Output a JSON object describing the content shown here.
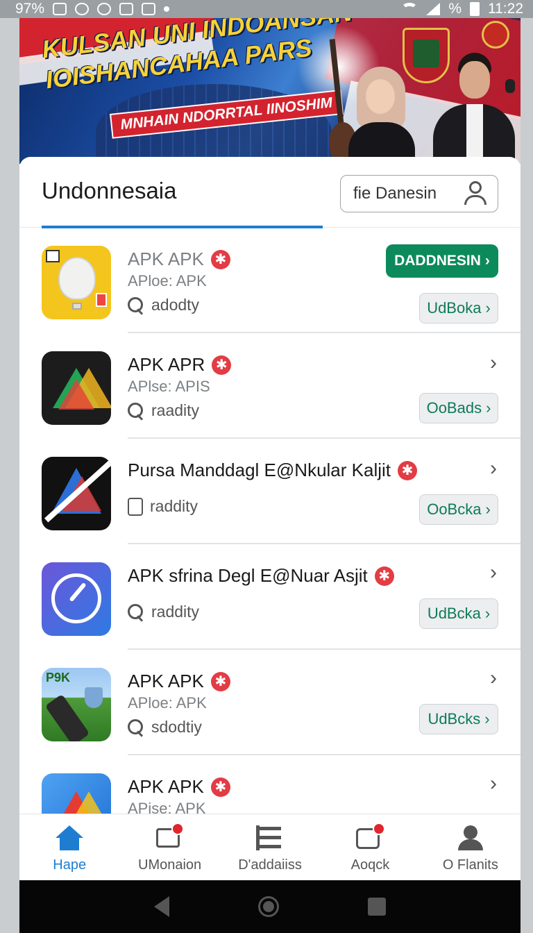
{
  "status_bar": {
    "left_text": "97%",
    "right_pct": "%",
    "time": "11:22"
  },
  "banner": {
    "title_line1": "KULSAN UNI INDOANSAN",
    "title_line2": "IOISHANCAHAA PARS",
    "subtitle": "MNHAIN NDORRTAL IINOSHIM"
  },
  "header": {
    "title": "Undonnesaia",
    "button_label": "fie Danesin"
  },
  "apps": [
    {
      "title": "APK APK",
      "sub": "APloe: APK",
      "meta": "adodty",
      "meta_icon": "search-icon",
      "primary_label": "DADDNESIN",
      "action_label": "UdBoka",
      "title_muted": true
    },
    {
      "title": "APK APR",
      "sub": "APlse: APIS",
      "meta": "raadity",
      "meta_icon": "search-icon",
      "action_label": "OoBads"
    },
    {
      "title": "Pursa Manddagl E@Nkular Kaljit",
      "sub": "",
      "meta": "raddity",
      "meta_icon": "lock-icon",
      "action_label": "OoBcka"
    },
    {
      "title": "APK sfrina Degl E@Nuar Asjit",
      "sub": "",
      "meta": "raddity",
      "meta_icon": "search-icon",
      "action_label": "UdBcka"
    },
    {
      "title": "APK APK",
      "sub": "APloe: APK",
      "meta": "sdodtiy",
      "meta_icon": "search-icon",
      "action_label": "UdBcks",
      "icon_text": "P9K"
    },
    {
      "title": "APK APK",
      "sub": "APise: APK",
      "meta": "",
      "meta_icon": "",
      "action_label": ""
    }
  ],
  "bottom_nav": [
    {
      "label": "Hape",
      "icon": "home-icon",
      "active": true
    },
    {
      "label": "UMonaion",
      "icon": "message-icon",
      "badge": true
    },
    {
      "label": "D'addaiiss",
      "icon": "list-icon"
    },
    {
      "label": "Aoqck",
      "icon": "calendar-icon",
      "badge": true
    },
    {
      "label": "O Flanits",
      "icon": "person-icon"
    }
  ],
  "colors": {
    "accent_blue": "#1e7dd0",
    "primary_green": "#0d8a5c",
    "badge_red": "#e23c45"
  }
}
